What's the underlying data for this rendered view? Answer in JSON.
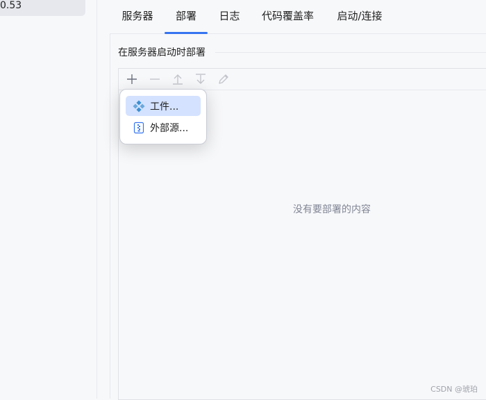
{
  "left_panel": {
    "item_text": "0.53"
  },
  "tabs": [
    {
      "label": "服务器"
    },
    {
      "label": "部署"
    },
    {
      "label": "日志"
    },
    {
      "label": "代码覆盖率"
    },
    {
      "label": "启动/连接"
    }
  ],
  "active_tab": "部署",
  "section": {
    "title": "在服务器启动时部署"
  },
  "toolbar": {
    "add_icon": "plus-icon",
    "remove_icon": "minus-icon",
    "move_up_icon": "arrow-up-icon",
    "move_down_icon": "arrow-down-icon",
    "edit_icon": "pencil-icon"
  },
  "empty_state": "没有要部署的内容",
  "popup_menu": {
    "items": [
      {
        "label": "工件...",
        "icon": "artifact-icon"
      },
      {
        "label": "外部源...",
        "icon": "external-source-icon"
      }
    ]
  },
  "watermark": "CSDN @琥珀",
  "colors": {
    "accent": "#3574f0",
    "selection": "#d4e2ff"
  }
}
